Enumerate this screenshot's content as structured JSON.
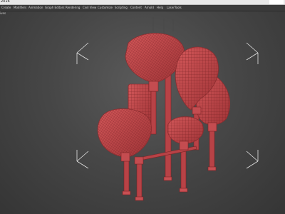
{
  "window": {
    "title": "2016"
  },
  "menu": {
    "items": [
      {
        "label": "Create"
      },
      {
        "label": "Modifiers"
      },
      {
        "label": "Animation"
      },
      {
        "label": "Graph Editors"
      },
      {
        "label": "Rendering"
      },
      {
        "label": "Civil View"
      },
      {
        "label": "Customize"
      },
      {
        "label": "Scripting"
      },
      {
        "label": "Content"
      },
      {
        "label": "Arnold"
      },
      {
        "label": "Help"
      },
      {
        "label": "LaserTools"
      }
    ]
  },
  "viewport": {
    "label": "ives",
    "object_color": "#c0474a",
    "background_color": "#474747"
  }
}
